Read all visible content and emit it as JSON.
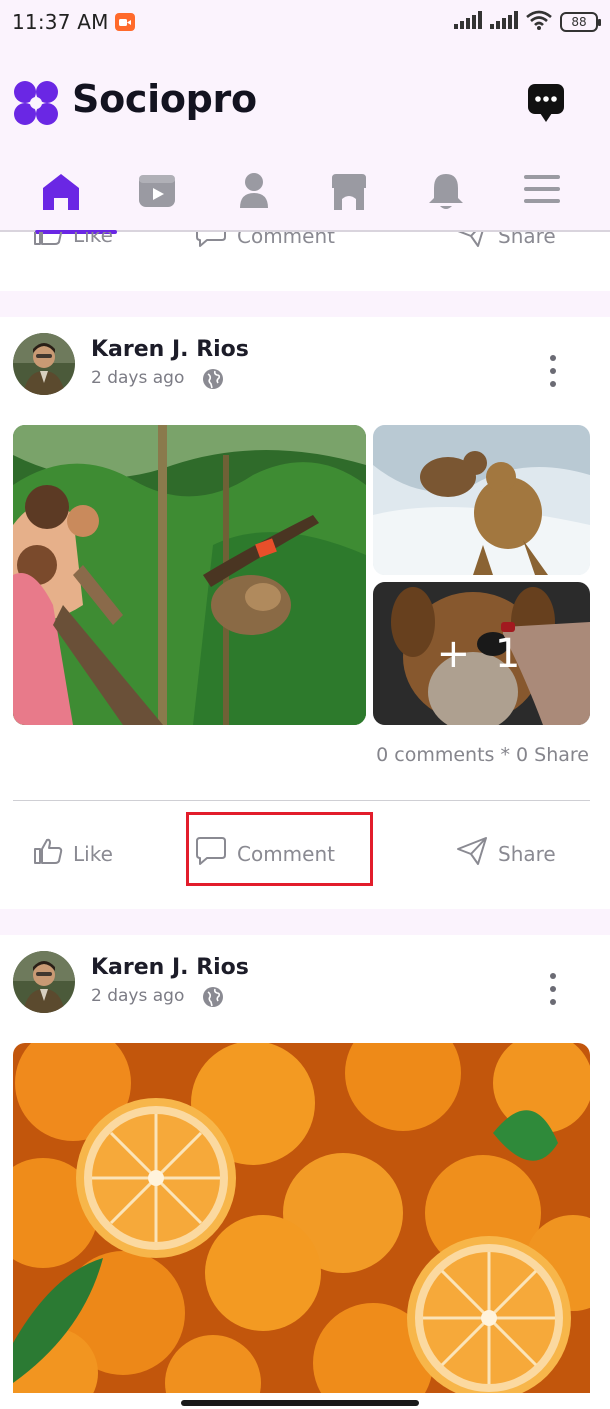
{
  "status_bar": {
    "time": "11:37 AM",
    "battery": "88",
    "icons": [
      "video-record-icon",
      "signal-icon",
      "signal-icon",
      "wifi-icon",
      "battery-icon"
    ]
  },
  "header": {
    "brand": "Sociopro",
    "logo_icon": "clover-logo-icon",
    "messages_icon": "chat-bubble-icon",
    "brand_color": "#6a27e4"
  },
  "tabs": [
    {
      "name": "home",
      "icon": "home-icon",
      "active": true
    },
    {
      "name": "videos",
      "icon": "video-icon",
      "active": false
    },
    {
      "name": "profile",
      "icon": "user-icon",
      "active": false
    },
    {
      "name": "marketplace",
      "icon": "store-icon",
      "active": false
    },
    {
      "name": "notifications",
      "icon": "bell-icon",
      "active": false
    },
    {
      "name": "menu",
      "icon": "menu-icon",
      "active": false
    }
  ],
  "actions": {
    "like": "Like",
    "comment": "Comment",
    "share": "Share"
  },
  "posts": [
    {
      "author": "Karen J. Rios",
      "time": "2 days ago",
      "visibility_icon": "globe-icon",
      "images": [
        "sloth-zoo-photo",
        "bears-river-photo",
        "dog-treat-photo"
      ],
      "more_count": "+ 1",
      "stats": "0 comments * 0 Share"
    },
    {
      "author": "Karen J. Rios",
      "time": "2 days ago",
      "visibility_icon": "globe-icon",
      "images": [
        "oranges-photo"
      ]
    }
  ],
  "colors": {
    "accent": "#6a27e4",
    "header_bg": "#fbf3fd",
    "highlight": "#e21d2b",
    "muted_text": "#8a8a92"
  }
}
